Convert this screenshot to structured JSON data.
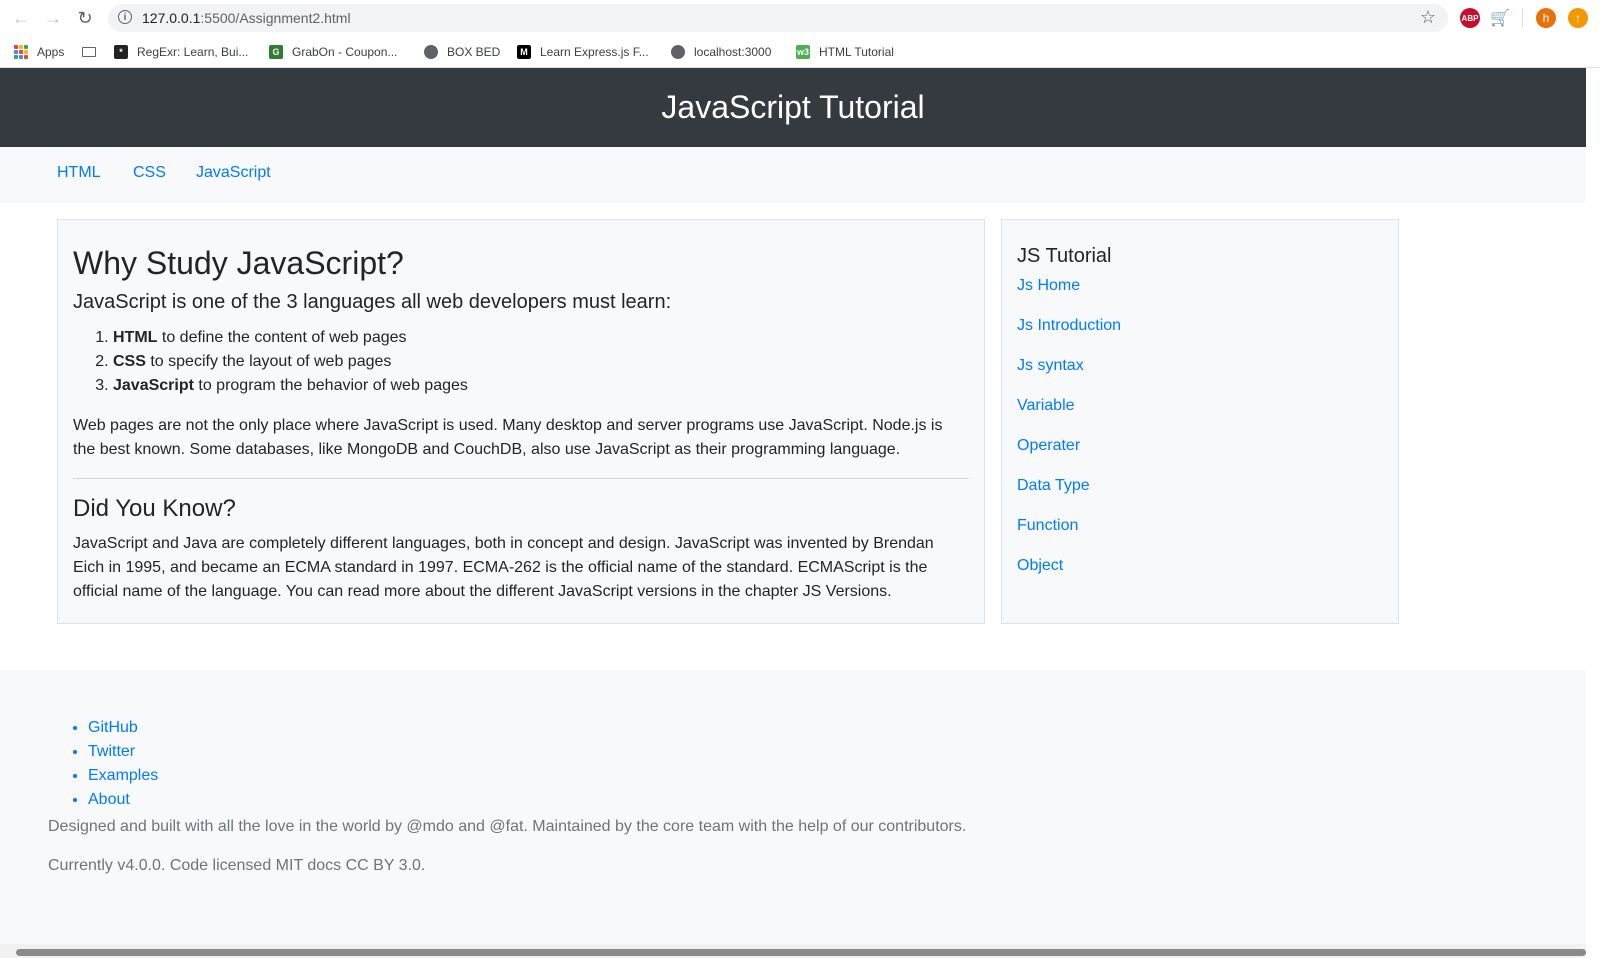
{
  "browser": {
    "url_host": "127.0.0.1",
    "url_path": ":5500/Assignment2.html",
    "profile_initial": "h",
    "abp_label": "ABP",
    "bookmarks": [
      {
        "label": "Apps",
        "icon": "apps-grid-icon"
      },
      {
        "label": "",
        "icon": "folder-icon"
      },
      {
        "label": "RegExr: Learn, Bui...",
        "icon": "regexr-icon"
      },
      {
        "label": "GrabOn - Coupon...",
        "icon": "grabon-icon"
      },
      {
        "label": "BOX BED",
        "icon": "globe-icon"
      },
      {
        "label": "Learn Express.js F...",
        "icon": "medium-icon"
      },
      {
        "label": "localhost:3000",
        "icon": "globe-icon"
      },
      {
        "label": "HTML Tutorial",
        "icon": "w3schools-icon"
      }
    ]
  },
  "site": {
    "title": "JavaScript Tutorial",
    "nav": [
      "HTML",
      "CSS",
      "JavaScript"
    ]
  },
  "main": {
    "heading": "Why Study JavaScript?",
    "subheading": "JavaScript is one of the 3 languages all web developers must learn:",
    "list": [
      {
        "bold": "HTML",
        "text": " to define the content of web pages"
      },
      {
        "bold": "CSS",
        "text": " to specify the layout of web pages"
      },
      {
        "bold": "JavaScript",
        "text": " to program the behavior of web pages"
      }
    ],
    "paragraph": "Web pages are not the only place where JavaScript is used. Many desktop and server programs use JavaScript. Node.js is the best known. Some databases, like MongoDB and CouchDB, also use JavaScript as their programming language.",
    "did_you_know_heading": "Did You Know?",
    "did_you_know_text": "JavaScript and Java are completely different languages, both in concept and design. JavaScript was invented by Brendan Eich in 1995, and became an ECMA standard in 1997. ECMA-262 is the official name of the standard. ECMAScript is the official name of the language. You can read more about the different JavaScript versions in the chapter JS Versions."
  },
  "sidebar": {
    "title": "JS Tutorial",
    "links": [
      "Js Home",
      "Js Introduction",
      "Js syntax",
      "Variable",
      "Operater",
      "Data Type",
      "Function",
      "Object"
    ]
  },
  "footer": {
    "links": [
      "GitHub",
      "Twitter",
      "Examples",
      "About"
    ],
    "credit": "Designed and built with all the love in the world by @mdo and @fat. Maintained by the core team with the help of our contributors.",
    "license": "Currently v4.0.0. Code licensed MIT docs CC BY 3.0."
  },
  "colors": {
    "header_bg": "#343a40",
    "link": "#007bff",
    "panel_bg": "#f8f9fa"
  }
}
